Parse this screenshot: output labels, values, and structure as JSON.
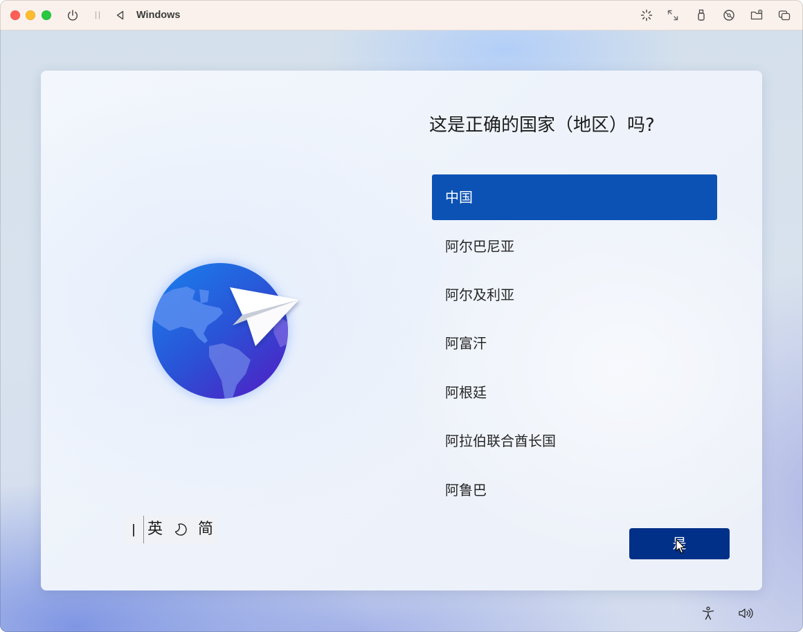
{
  "window": {
    "title": "Windows",
    "titlebar_color": "#faf1ec",
    "controls": [
      {
        "icon": "close-button",
        "color": "#ff5f57"
      },
      {
        "icon": "minimize-button",
        "color": "#febc2e"
      },
      {
        "icon": "zoom-button",
        "color": "#28c840"
      }
    ],
    "toolbar_left": [
      "power-icon",
      "pause-icon",
      "previous-icon"
    ],
    "toolbar_right": [
      "activity-icon",
      "fullscreen-icon",
      "usb-device-icon",
      "cd-dvd-icon",
      "shared-folder-icon",
      "window-mode-icon"
    ]
  },
  "oobe": {
    "illustration": [
      "globe-icon",
      "paper-plane-icon"
    ],
    "heading": "这是正确的国家（地区）吗?",
    "regions": [
      "中国",
      "阿尔巴尼亚",
      "阿尔及利亚",
      "阿富汗",
      "阿根廷",
      "阿拉伯联合酋长国",
      "阿鲁巴"
    ],
    "selected_index": 0,
    "confirm_button": "是",
    "colors": {
      "selected": "#0b52b4",
      "button": "#003088"
    }
  },
  "ime": {
    "icons": [
      "drag-handle-icon",
      "half-width-moon-icon"
    ],
    "input_mode": "英",
    "script_mode": "简"
  },
  "system_tray": {
    "icons": [
      "accessibility-icon",
      "volume-icon"
    ]
  }
}
